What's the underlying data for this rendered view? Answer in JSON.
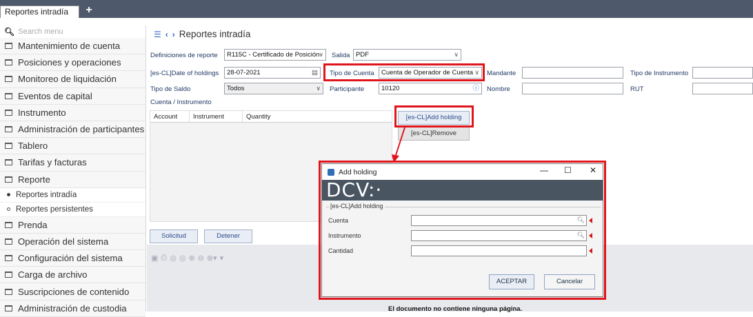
{
  "topbar": {
    "tab_label": "Reportes intradía",
    "add_tab": "+"
  },
  "sidebar": {
    "search_placeholder": "Search menu",
    "items": [
      "Mantenimiento de cuenta",
      "Posiciones y operaciones",
      "Monitoreo de liquidación",
      "Eventos de capital",
      "Instrumento",
      "Administración de participantes",
      "Tablero",
      "Tarifas y facturas",
      "Reporte",
      "Prenda",
      "Operación del sistema",
      "Configuración del sistema",
      "Carga de archivo",
      "Suscripciones de contenido",
      "Administración de custodia"
    ],
    "sub_items": [
      "Reportes intradía",
      "Reportes persistentes"
    ]
  },
  "main": {
    "title": "Reportes intradía",
    "form": {
      "def_label": "Definiciones de reporte",
      "def_value": "R115C - Certificado de Posición",
      "salida_label": "Salida",
      "salida_value": "PDF",
      "date_label": "[es-CL]Date of holdings",
      "date_value": "28-07-2021",
      "tipo_cuenta_label": "Tipo de Cuenta",
      "tipo_cuenta_value": "Cuenta de Operador de Cuenta",
      "mandante_label": "Mandante",
      "tipo_instr_label": "Tipo de Instrumento",
      "tipo_saldo_label": "Tipo de Saldo",
      "tipo_saldo_value": "Todos",
      "participante_label": "Participante",
      "participante_value": "10120",
      "nombre_label": "Nombre",
      "rut_label": "RUT",
      "cuenta_instr_label": "Cuenta / Instrumento"
    },
    "grid_columns": [
      "Account",
      "Instrument",
      "Quantity"
    ],
    "add_holding_btn": "[es-CL]Add holding",
    "remove_btn": "[es-CL]Remove",
    "solicitud_btn": "Solicitud",
    "detener_btn": "Detener",
    "doc_message": "El documento no contiene ninguna página."
  },
  "modal": {
    "title": "Add holding",
    "brand": "DCV:·",
    "group_label": "[es-CL]Add holding",
    "cuenta_label": "Cuenta",
    "instrumento_label": "Instrumento",
    "cantidad_label": "Cantidad",
    "ok_btn": "ACEPTAR",
    "cancel_btn": "Cancelar",
    "min": "—",
    "max": "☐",
    "close": "✕"
  },
  "colors": {
    "highlight": "#e0141b",
    "topbar": "#4e5a6b",
    "brand_bar": "#4a5562"
  }
}
